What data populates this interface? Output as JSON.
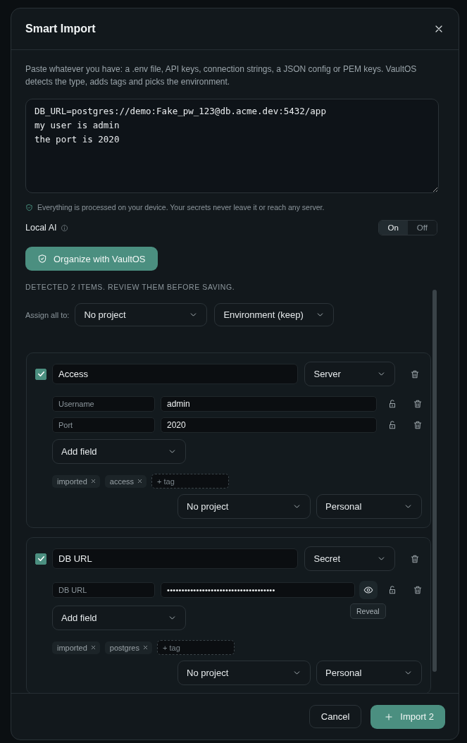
{
  "dialog": {
    "title": "Smart Import",
    "description": "Paste whatever you have: a .env file, API keys, connection strings, a JSON config or PEM keys. VaultOS detects the type, adds tags and picks the environment.",
    "input_text": "DB_URL=postgres://demo:Fake_pw_123@db.acme.dev:5432/app\nmy user is admin\nthe port is 2020",
    "privacy_note": "Everything is processed on your device. Your secrets never leave it or reach any server.",
    "local_ai": {
      "label": "Local AI",
      "options": [
        {
          "label": "On",
          "selected": true
        },
        {
          "label": "Off",
          "selected": false
        }
      ]
    },
    "organize_button": "Organize with VaultOS",
    "detected_text": "DETECTED 2 ITEMS. REVIEW THEM BEFORE SAVING.",
    "assign": {
      "label": "Assign all to:",
      "project": "No project",
      "environment": "Environment (keep)"
    },
    "items": [
      {
        "checked": true,
        "name": "Access",
        "type": "Server",
        "fields": [
          {
            "kind": "text",
            "label": "Username",
            "value": "admin",
            "locked": false
          },
          {
            "kind": "text",
            "label": "Port",
            "value": "2020",
            "locked": false
          }
        ],
        "add_field": "Add field",
        "tags": [
          "imported",
          "access"
        ],
        "tag_placeholder": "+ tag",
        "project": "No project",
        "environment": "Personal"
      },
      {
        "checked": true,
        "name": "DB URL",
        "type": "Secret",
        "fields": [
          {
            "kind": "secret",
            "label": "DB URL",
            "value": "•••••••••••••••••••••••••••••••••••••",
            "locked": false,
            "tooltip": "Reveal"
          }
        ],
        "add_field": "Add field",
        "tags": [
          "imported",
          "postgres"
        ],
        "tag_placeholder": "+ tag",
        "project": "No project",
        "environment": "Personal"
      }
    ],
    "footer": {
      "cancel": "Cancel",
      "import": "Import 2"
    }
  }
}
